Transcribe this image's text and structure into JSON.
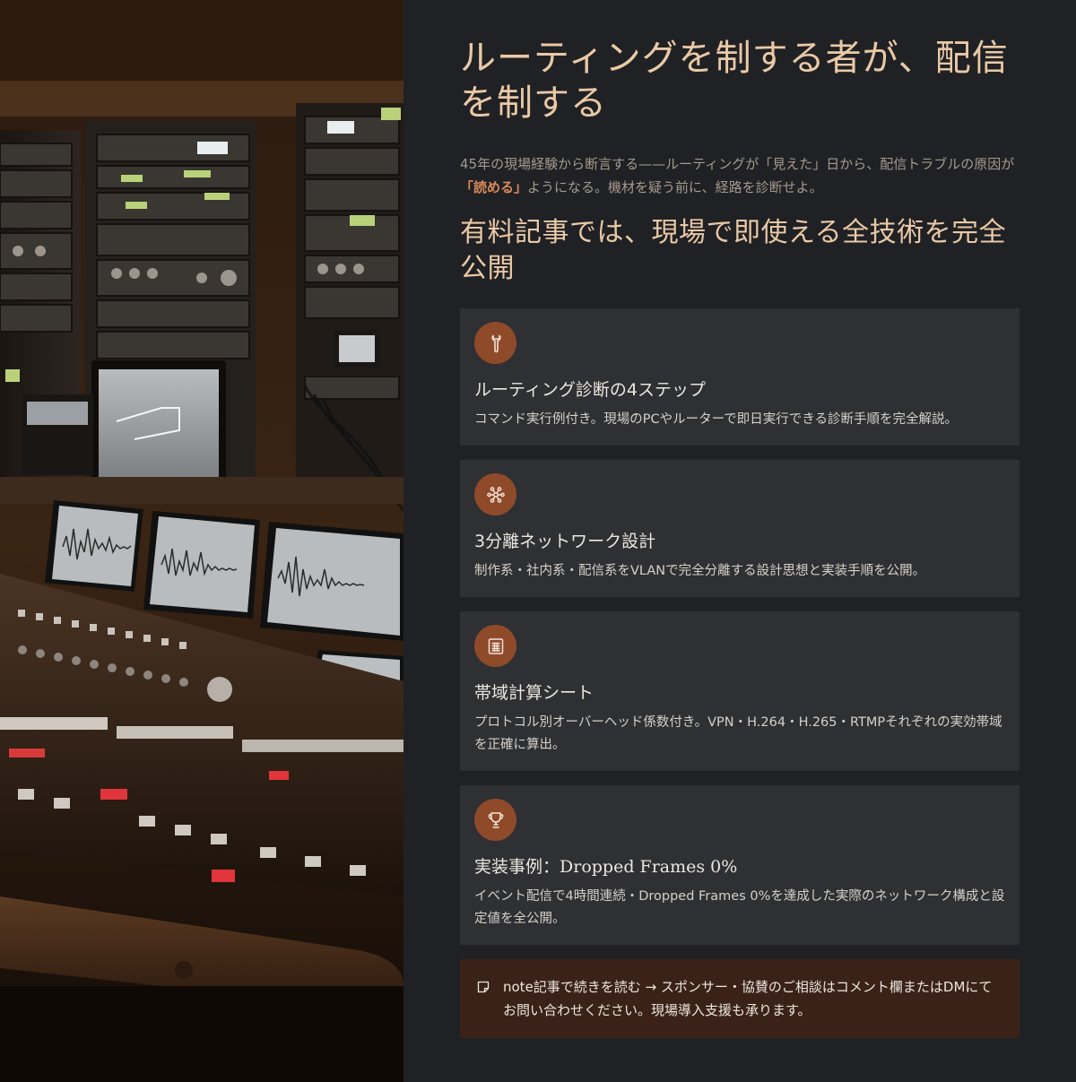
{
  "hero_title": "ルーティングを制する者が、配信を制する",
  "lead": {
    "before": "45年の現場経験から断言する——ルーティングが「見えた」日から、配信トラブルの原因が",
    "highlight": "「読める」",
    "after": "ようになる。機材を疑う前に、経路を診断せよ。"
  },
  "section_title": "有料記事では、現場で即使える全技術を完全公開",
  "cards": [
    {
      "icon": "wrench-icon",
      "title": "ルーティング診断の4ステップ",
      "desc": "コマンド実行例付き。現場のPCやルーターで即日実行できる診断手順を完全解説。"
    },
    {
      "icon": "network-icon",
      "title": "3分離ネットワーク設計",
      "desc": "制作系・社内系・配信系をVLANで完全分離する設計思想と実装手順を公開。"
    },
    {
      "icon": "spreadsheet-icon",
      "title": "帯域計算シート",
      "desc": "プロトコル別オーバーヘッド係数付き。VPN・H.264・H.265・RTMPそれぞれの実効帯域を正確に算出。"
    },
    {
      "icon": "trophy-icon",
      "title": "実装事例：Dropped Frames 0%",
      "desc": "イベント配信で4時間連続・Dropped Frames 0%を達成した実際のネットワーク構成と設定値を全公開。"
    }
  ],
  "note": {
    "icon": "note-icon",
    "text": "note記事で続きを読む → スポンサー・協賛のご相談はコメント欄またはDMにてお問い合わせください。現場導入支援も承ります。"
  },
  "colors": {
    "background": "#202124",
    "accent": "#8f4a2a",
    "title": "#e9c9a6",
    "highlight": "#d8895a",
    "card": "#2f3033",
    "note_bg": "#3b2219"
  },
  "photo": {
    "icon": "studio-console-photo"
  }
}
